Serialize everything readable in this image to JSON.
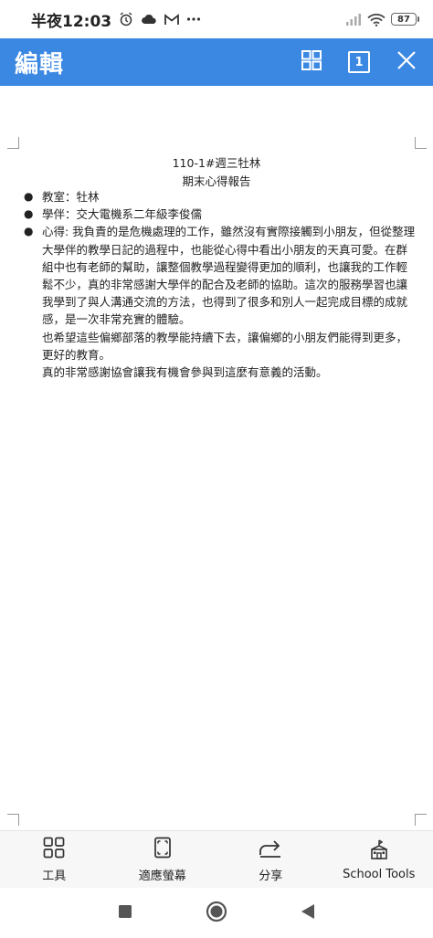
{
  "status_bar": {
    "time": "半夜12:03",
    "battery": "87",
    "icons": [
      "alarm-icon",
      "cloud-icon",
      "gmail-icon",
      "more-dots-icon",
      "signal-icon",
      "wifi-icon",
      "battery-icon"
    ]
  },
  "app_bar": {
    "title": "編輯",
    "page_indicator": "1",
    "background": "#3b88e3",
    "icons": [
      "grid-view-icon",
      "page-icon",
      "close-icon"
    ]
  },
  "document": {
    "title": "110-1#週三牡林",
    "subtitle": "期末心得報告",
    "bullets": [
      {
        "label": "教室：牡林"
      },
      {
        "label": "學伴：交大電機系二年級李俊儒"
      },
      {
        "label": "心得: 我負責的是危機處理的工作，雖然沒有實際接觸到小朋友，但從整理大學伴的教學日記的過程中，也能從心得中看出小朋友的天真可愛。在群組中也有老師的幫助，讓整個教學過程變得更加的順利，也讓我的工作輕鬆不少，真的非常感謝大學伴的配合及老師的協助。這次的服務學習也讓我學到了與人溝通交流的方法，也得到了很多和別人一起完成目標的成就感，是一次非常充實的體驗。"
      }
    ],
    "paragraphs": [
      "也希望這些偏鄉部落的教學能持續下去，讓偏鄉的小朋友們能得到更多，更好的教育。",
      "真的非常感謝協會讓我有機會參與到這麼有意義的活動。"
    ]
  },
  "bottom_toolbar": {
    "tools": [
      {
        "label": "工具",
        "icon": "tools-grid-icon"
      },
      {
        "label": "適應螢幕",
        "icon": "fit-screen-icon"
      },
      {
        "label": "分享",
        "icon": "share-icon"
      },
      {
        "label": "School Tools",
        "icon": "school-icon"
      }
    ]
  },
  "nav_bar": {
    "icons": [
      "recents-square-icon",
      "home-circle-icon",
      "back-triangle-icon"
    ]
  }
}
